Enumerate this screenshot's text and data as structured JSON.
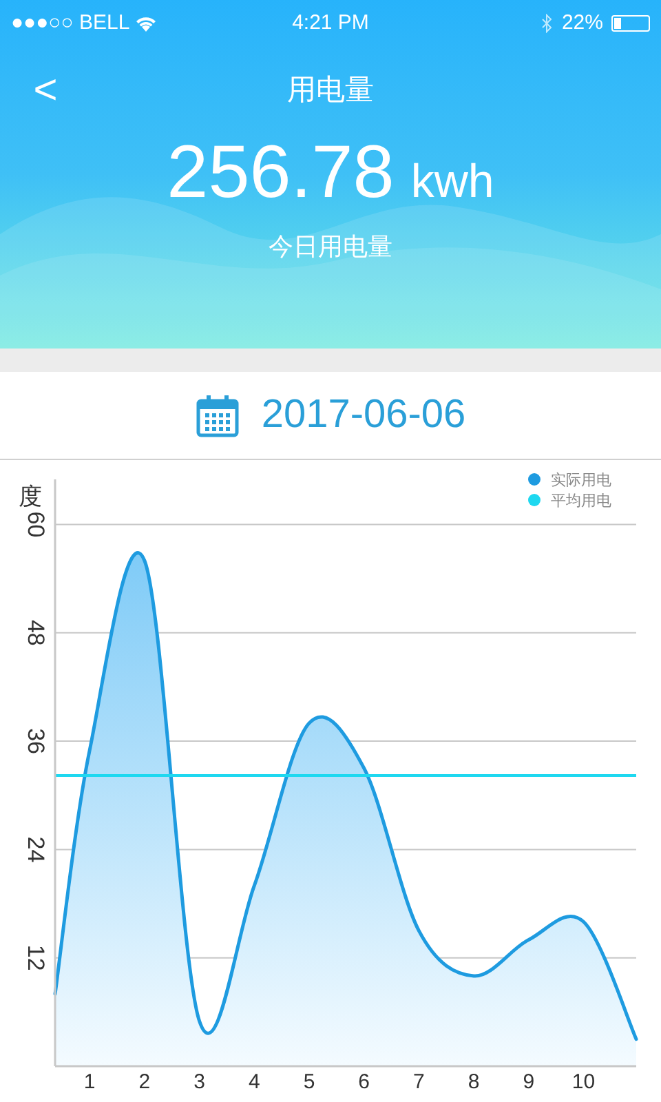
{
  "status_bar": {
    "carrier": "●●●○○ BELL",
    "time": "4:21 PM",
    "battery": "22%"
  },
  "header": {
    "back": "<",
    "title": "用电量",
    "value": "256.78",
    "unit": "kwh",
    "caption": "今日用电量"
  },
  "date": "2017-06-06",
  "chart": {
    "chart_data": {
      "type": "area",
      "ylabel": "度",
      "x": [
        0.37,
        1,
        2,
        3,
        4,
        5,
        6,
        7,
        8,
        9,
        10,
        10.96
      ],
      "xlim": [
        0.37,
        10.96
      ],
      "xticks": [
        1,
        2,
        3,
        4,
        5,
        6,
        7,
        8,
        9,
        10
      ],
      "ylim": [
        0,
        65
      ],
      "yticks": [
        12,
        24,
        36,
        48,
        60
      ],
      "grid": true,
      "legend": true,
      "series": [
        {
          "name": "实际用电",
          "color": "#1e9be0",
          "values": [
            8,
            35,
            56,
            5,
            20,
            38,
            33,
            15,
            10,
            14,
            16,
            3
          ]
        },
        {
          "name": "平均用电",
          "type": "line",
          "color": "#1ed8f0",
          "values": [
            32.2,
            32.2,
            32.2,
            32.2,
            32.2,
            32.2,
            32.2,
            32.2,
            32.2,
            32.2,
            32.2,
            32.2
          ]
        }
      ]
    }
  }
}
